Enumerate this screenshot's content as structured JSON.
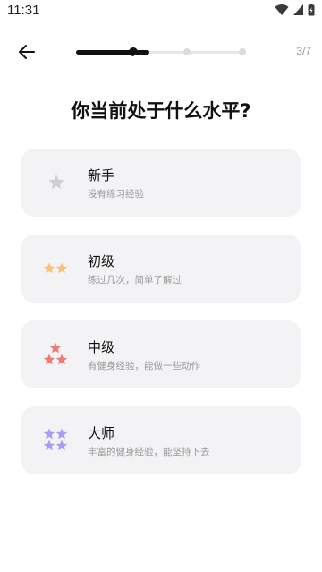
{
  "status_bar": {
    "time": "11:31",
    "icons": [
      "wifi-icon",
      "signal-icon",
      "battery-icon"
    ]
  },
  "header": {
    "back_icon": "arrow-left-icon",
    "step": "3/7",
    "progress_fraction": 0.43
  },
  "title": "你当前处于什么水平?",
  "options": [
    {
      "title": "新手",
      "desc": "没有练习经验",
      "stars": 1,
      "color": "#cfcfd3"
    },
    {
      "title": "初级",
      "desc": "练过几次，简单了解过",
      "stars": 2,
      "color": "#f6c27a"
    },
    {
      "title": "中级",
      "desc": "有健身经验，能做一些动作",
      "stars": 3,
      "color": "#ee7a7a"
    },
    {
      "title": "大师",
      "desc": "丰富的健身经验，能坚持下去",
      "stars": 4,
      "color": "#a99cf2"
    }
  ]
}
